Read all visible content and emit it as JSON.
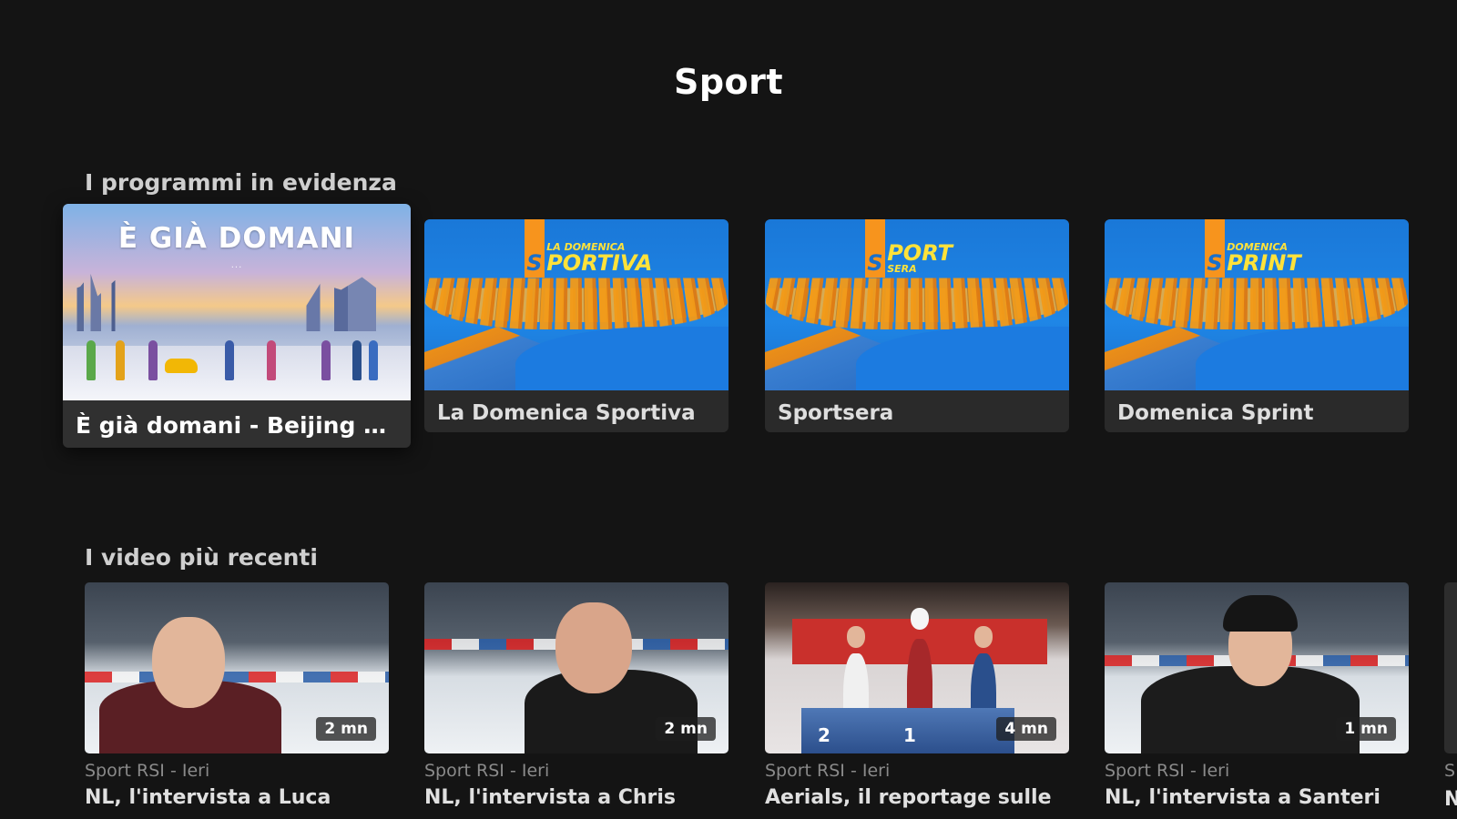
{
  "page": {
    "title": "Sport"
  },
  "featured": {
    "section_title": "I programmi in evidenza",
    "items": [
      {
        "label": "È già domani - Beijing 2...",
        "thumb_title": "È GIÀ DOMANI",
        "thumb_subtitle": "..."
      },
      {
        "label": "La Domenica Sportiva",
        "logo_initial": "S",
        "logo_small": "LA DOMENICA",
        "logo_big": "PORTIVA"
      },
      {
        "label": "Sportsera",
        "logo_initial": "S",
        "logo_small": "SERA",
        "logo_big": "PORT"
      },
      {
        "label": "Domenica Sprint",
        "logo_initial": "S",
        "logo_small": "DOMENICA",
        "logo_big": "PRINT"
      }
    ]
  },
  "recent": {
    "section_title": "I video più recenti",
    "items": [
      {
        "duration": "2 mn",
        "meta": "Sport RSI - Ieri",
        "title": "NL, l'intervista a Luca"
      },
      {
        "duration": "2 mn",
        "meta": "Sport RSI - Ieri",
        "title": "NL, l'intervista a Chris"
      },
      {
        "duration": "4 mn",
        "meta": "Sport RSI - Ieri",
        "title": "Aerials, il reportage sulle",
        "podium_left": "2",
        "podium_mid": "1"
      },
      {
        "duration": "1 mn",
        "meta": "Sport RSI - Ieri",
        "title": "NL, l'intervista a Santeri"
      }
    ],
    "peek": {
      "meta": "S",
      "title": "N"
    }
  },
  "colors": {
    "background": "#141414",
    "card": "#2a2a2a",
    "show_blue": "#1f86e6",
    "show_orange": "#f7941d",
    "logo_yellow": "#ffe23a"
  }
}
